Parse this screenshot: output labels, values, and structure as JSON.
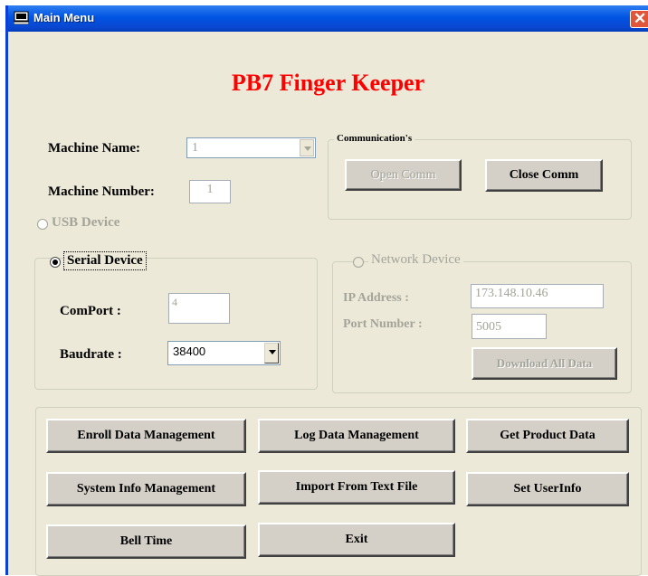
{
  "window": {
    "title": "Main Menu",
    "close_glyph": "✕"
  },
  "app_title": "PB7 Finger Keeper",
  "machine": {
    "name_label": "Machine Name:",
    "name_value": "1",
    "number_label": "Machine Number:",
    "number_value": "1"
  },
  "usb": {
    "label": "USB Device",
    "selected": false,
    "enabled": false
  },
  "serial": {
    "label": "Serial Device",
    "selected": true,
    "comport_label": "ComPort :",
    "comport_value": "4",
    "baudrate_label": "Baudrate :",
    "baudrate_value": "38400"
  },
  "communication": {
    "legend": "Communication's",
    "open_label": "Open Comm",
    "close_label": "Close Comm"
  },
  "network": {
    "label": "Network Device",
    "selected": false,
    "ip_label": "IP Address :",
    "ip_value": "173.148.10.46",
    "port_label": "Port Number :",
    "port_value": "5005",
    "download_label": "Download All Data"
  },
  "actions": {
    "enroll": "Enroll Data Management",
    "log": "Log Data Management",
    "product": "Get Product Data",
    "system_info": "System Info Management",
    "import_text": "Import From Text File",
    "set_user": "Set UserInfo",
    "bell": "Bell Time",
    "exit": "Exit"
  },
  "colors": {
    "title_red": "#ff0000",
    "titlebar_blue": "#0054e3",
    "face": "#ece9d8",
    "disabled_text": "#a4a499"
  }
}
